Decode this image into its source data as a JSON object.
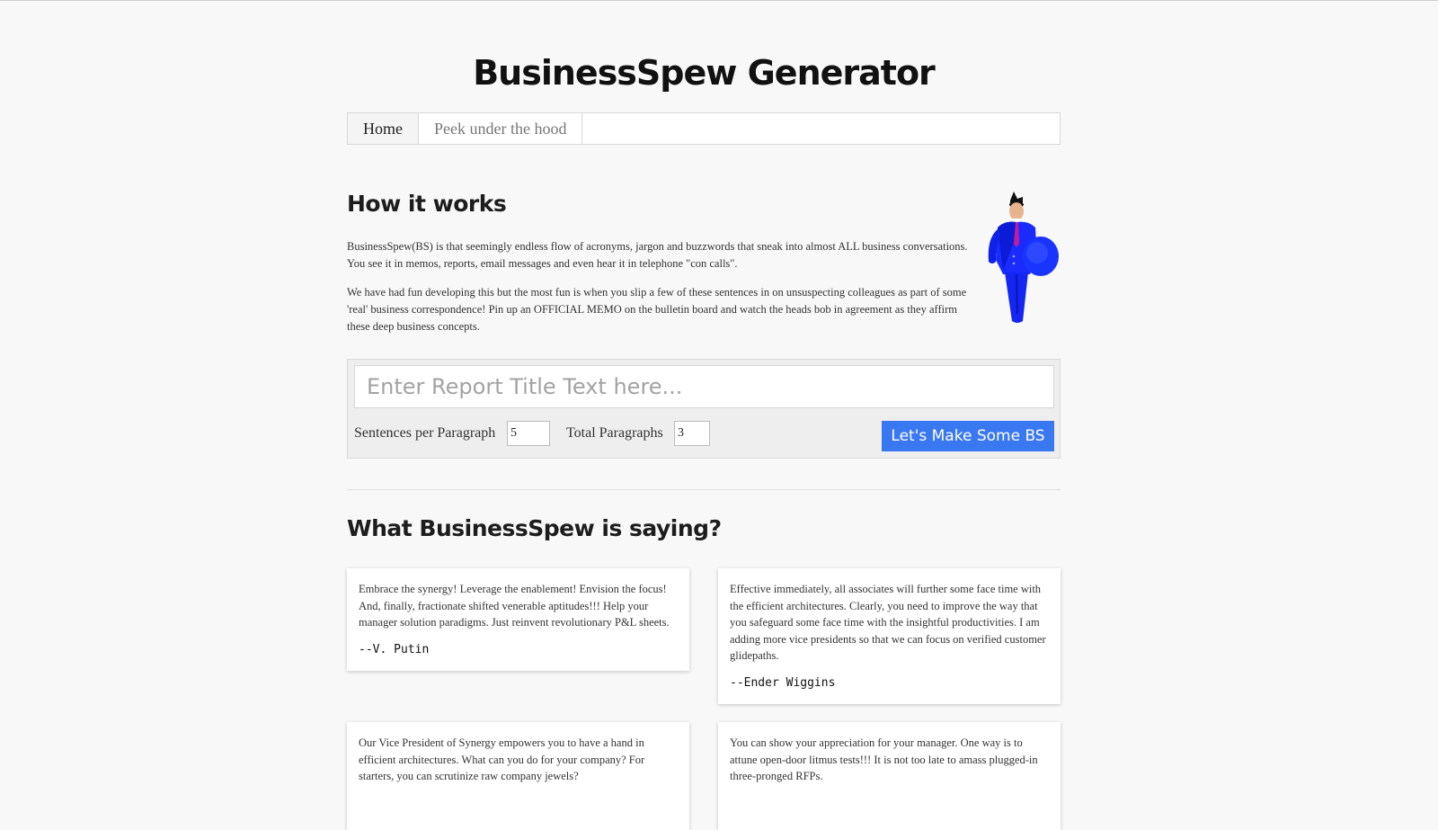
{
  "header": {
    "title": "BusinessSpew Generator"
  },
  "nav": {
    "tabs": [
      {
        "label": "Home",
        "active": true
      },
      {
        "label": "Peek under the hood",
        "active": false
      }
    ]
  },
  "how_it_works": {
    "heading": "How it works",
    "paragraphs": [
      "BusinessSpew(BS) is that seemingly endless flow of acronyms, jargon and buzzwords that sneak into almost ALL business conversations. You see it in memos, reports, email messages and even hear it in telephone \"con calls\".",
      "We have had fun developing this but the most fun is when you slip a few of these sentences in on unsuspecting colleagues as part of some 'real' business correspondence! Pin up an OFFICIAL MEMO on the bulletin board and watch the heads bob in agreement as they affirm these deep business concepts."
    ]
  },
  "form": {
    "title_placeholder": "Enter Report Title Text here...",
    "title_value": "",
    "sentences_label": "Sentences per Paragraph",
    "sentences_value": "5",
    "paragraphs_label": "Total Paragraphs",
    "paragraphs_value": "3",
    "submit_label": "Let's Make Some BS"
  },
  "quotes": {
    "heading": "What BusinessSpew is saying?",
    "items": [
      {
        "text": "Embrace the synergy! Leverage the enablement! Envision the focus! And, finally, fractionate shifted venerable aptitudes!!! Help your manager solution paradigms. Just reinvent revolutionary P&L sheets.",
        "author": "--V. Putin"
      },
      {
        "text": "Effective immediately, all associates will further some face time with the efficient architectures. Clearly, you need to improve the way that you safeguard some face time with the insightful productivities. I am adding more vice presidents so that we can focus on verified customer glidepaths.",
        "author": "--Ender Wiggins"
      },
      {
        "text": "Our Vice President of Synergy empowers you to have a hand in efficient architectures. What can you do for your company? For starters, you can scrutinize raw company jewels?",
        "author": ""
      },
      {
        "text": "You can show your appreciation for your manager. One way is to attune open-door litmus tests!!! It is not too late to amass plugged-in three-pronged RFPs.",
        "author": ""
      }
    ]
  },
  "colors": {
    "button_bg": "#3a78f2",
    "page_bg": "#f8f8f8",
    "mascot_suit": "#1a2bff"
  }
}
